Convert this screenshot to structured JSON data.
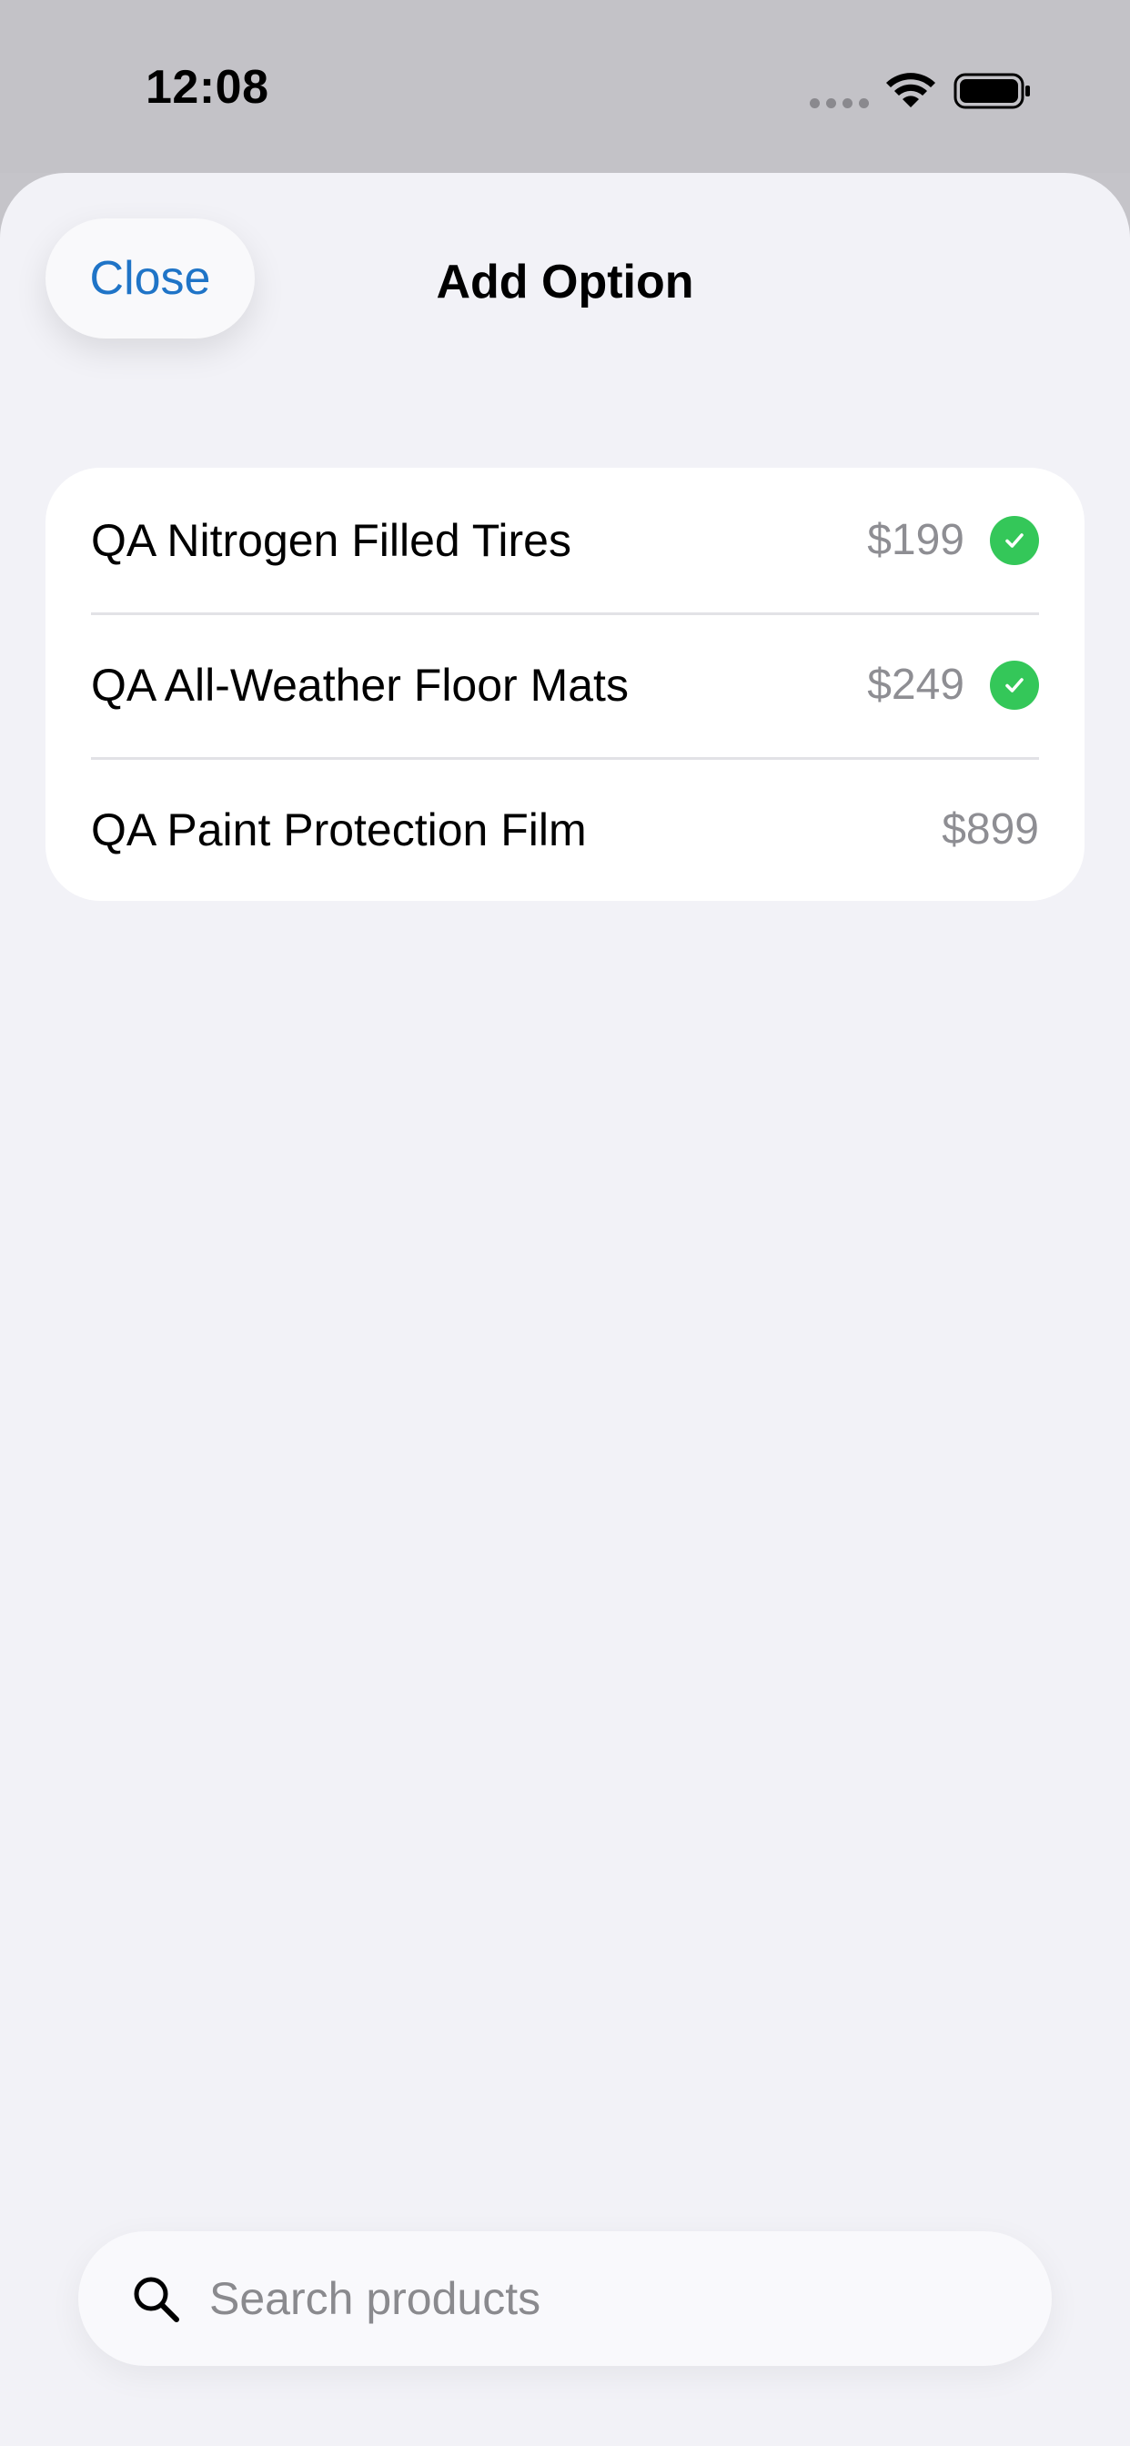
{
  "status_bar": {
    "time": "12:08"
  },
  "sheet": {
    "close_label": "Close",
    "title": "Add Option"
  },
  "options": [
    {
      "name": "QA Nitrogen Filled Tires",
      "price": "$199",
      "selected": true
    },
    {
      "name": "QA All-Weather Floor Mats",
      "price": "$249",
      "selected": true
    },
    {
      "name": "QA Paint Protection Film",
      "price": "$899",
      "selected": false
    }
  ],
  "search": {
    "placeholder": "Search products",
    "value": ""
  },
  "colors": {
    "accent": "#1f74c7",
    "check": "#34c759",
    "background": "#f2f2f7"
  }
}
